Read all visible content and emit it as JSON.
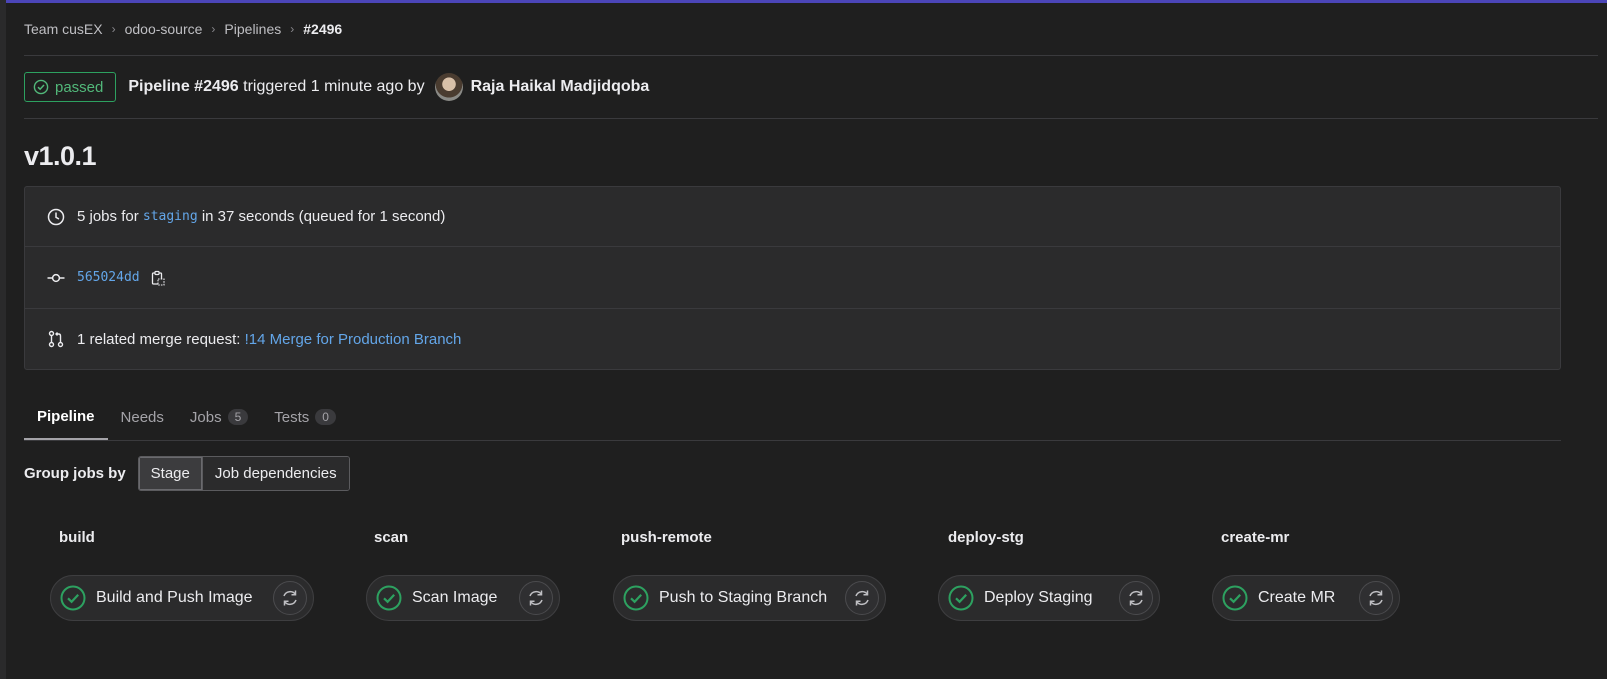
{
  "breadcrumb": {
    "items": [
      "Team cusEX",
      "odoo-source",
      "Pipelines"
    ],
    "current": "#2496"
  },
  "header": {
    "status": "passed",
    "pipeline": "Pipeline #2496",
    "triggered_text": "triggered 1 minute ago by",
    "author": "Raja Haikal Madjidqoba"
  },
  "version": "v1.0.1",
  "info": {
    "jobs_prefix": "5 jobs for",
    "branch": "staging",
    "jobs_suffix": "in 37 seconds (queued for 1 second)",
    "commit": "565024dd",
    "mr_prefix": "1 related merge request:",
    "mr_link": "!14 Merge for Production Branch"
  },
  "tabs": [
    {
      "label": "Pipeline",
      "count": null
    },
    {
      "label": "Needs",
      "count": null
    },
    {
      "label": "Jobs",
      "count": "5"
    },
    {
      "label": "Tests",
      "count": "0"
    }
  ],
  "groupby": {
    "label": "Group jobs by",
    "options": [
      "Stage",
      "Job dependencies"
    ],
    "selected": "Stage"
  },
  "stages": [
    {
      "title": "build",
      "job": "Build and Push Image"
    },
    {
      "title": "scan",
      "job": "Scan Image"
    },
    {
      "title": "push-remote",
      "job": "Push to Staging Branch"
    },
    {
      "title": "deploy-stg",
      "job": "Deploy Staging"
    },
    {
      "title": "create-mr",
      "job": "Create MR"
    }
  ],
  "colors": {
    "success": "#2da160",
    "link": "#63a6e9",
    "background": "#1f1f1f"
  }
}
